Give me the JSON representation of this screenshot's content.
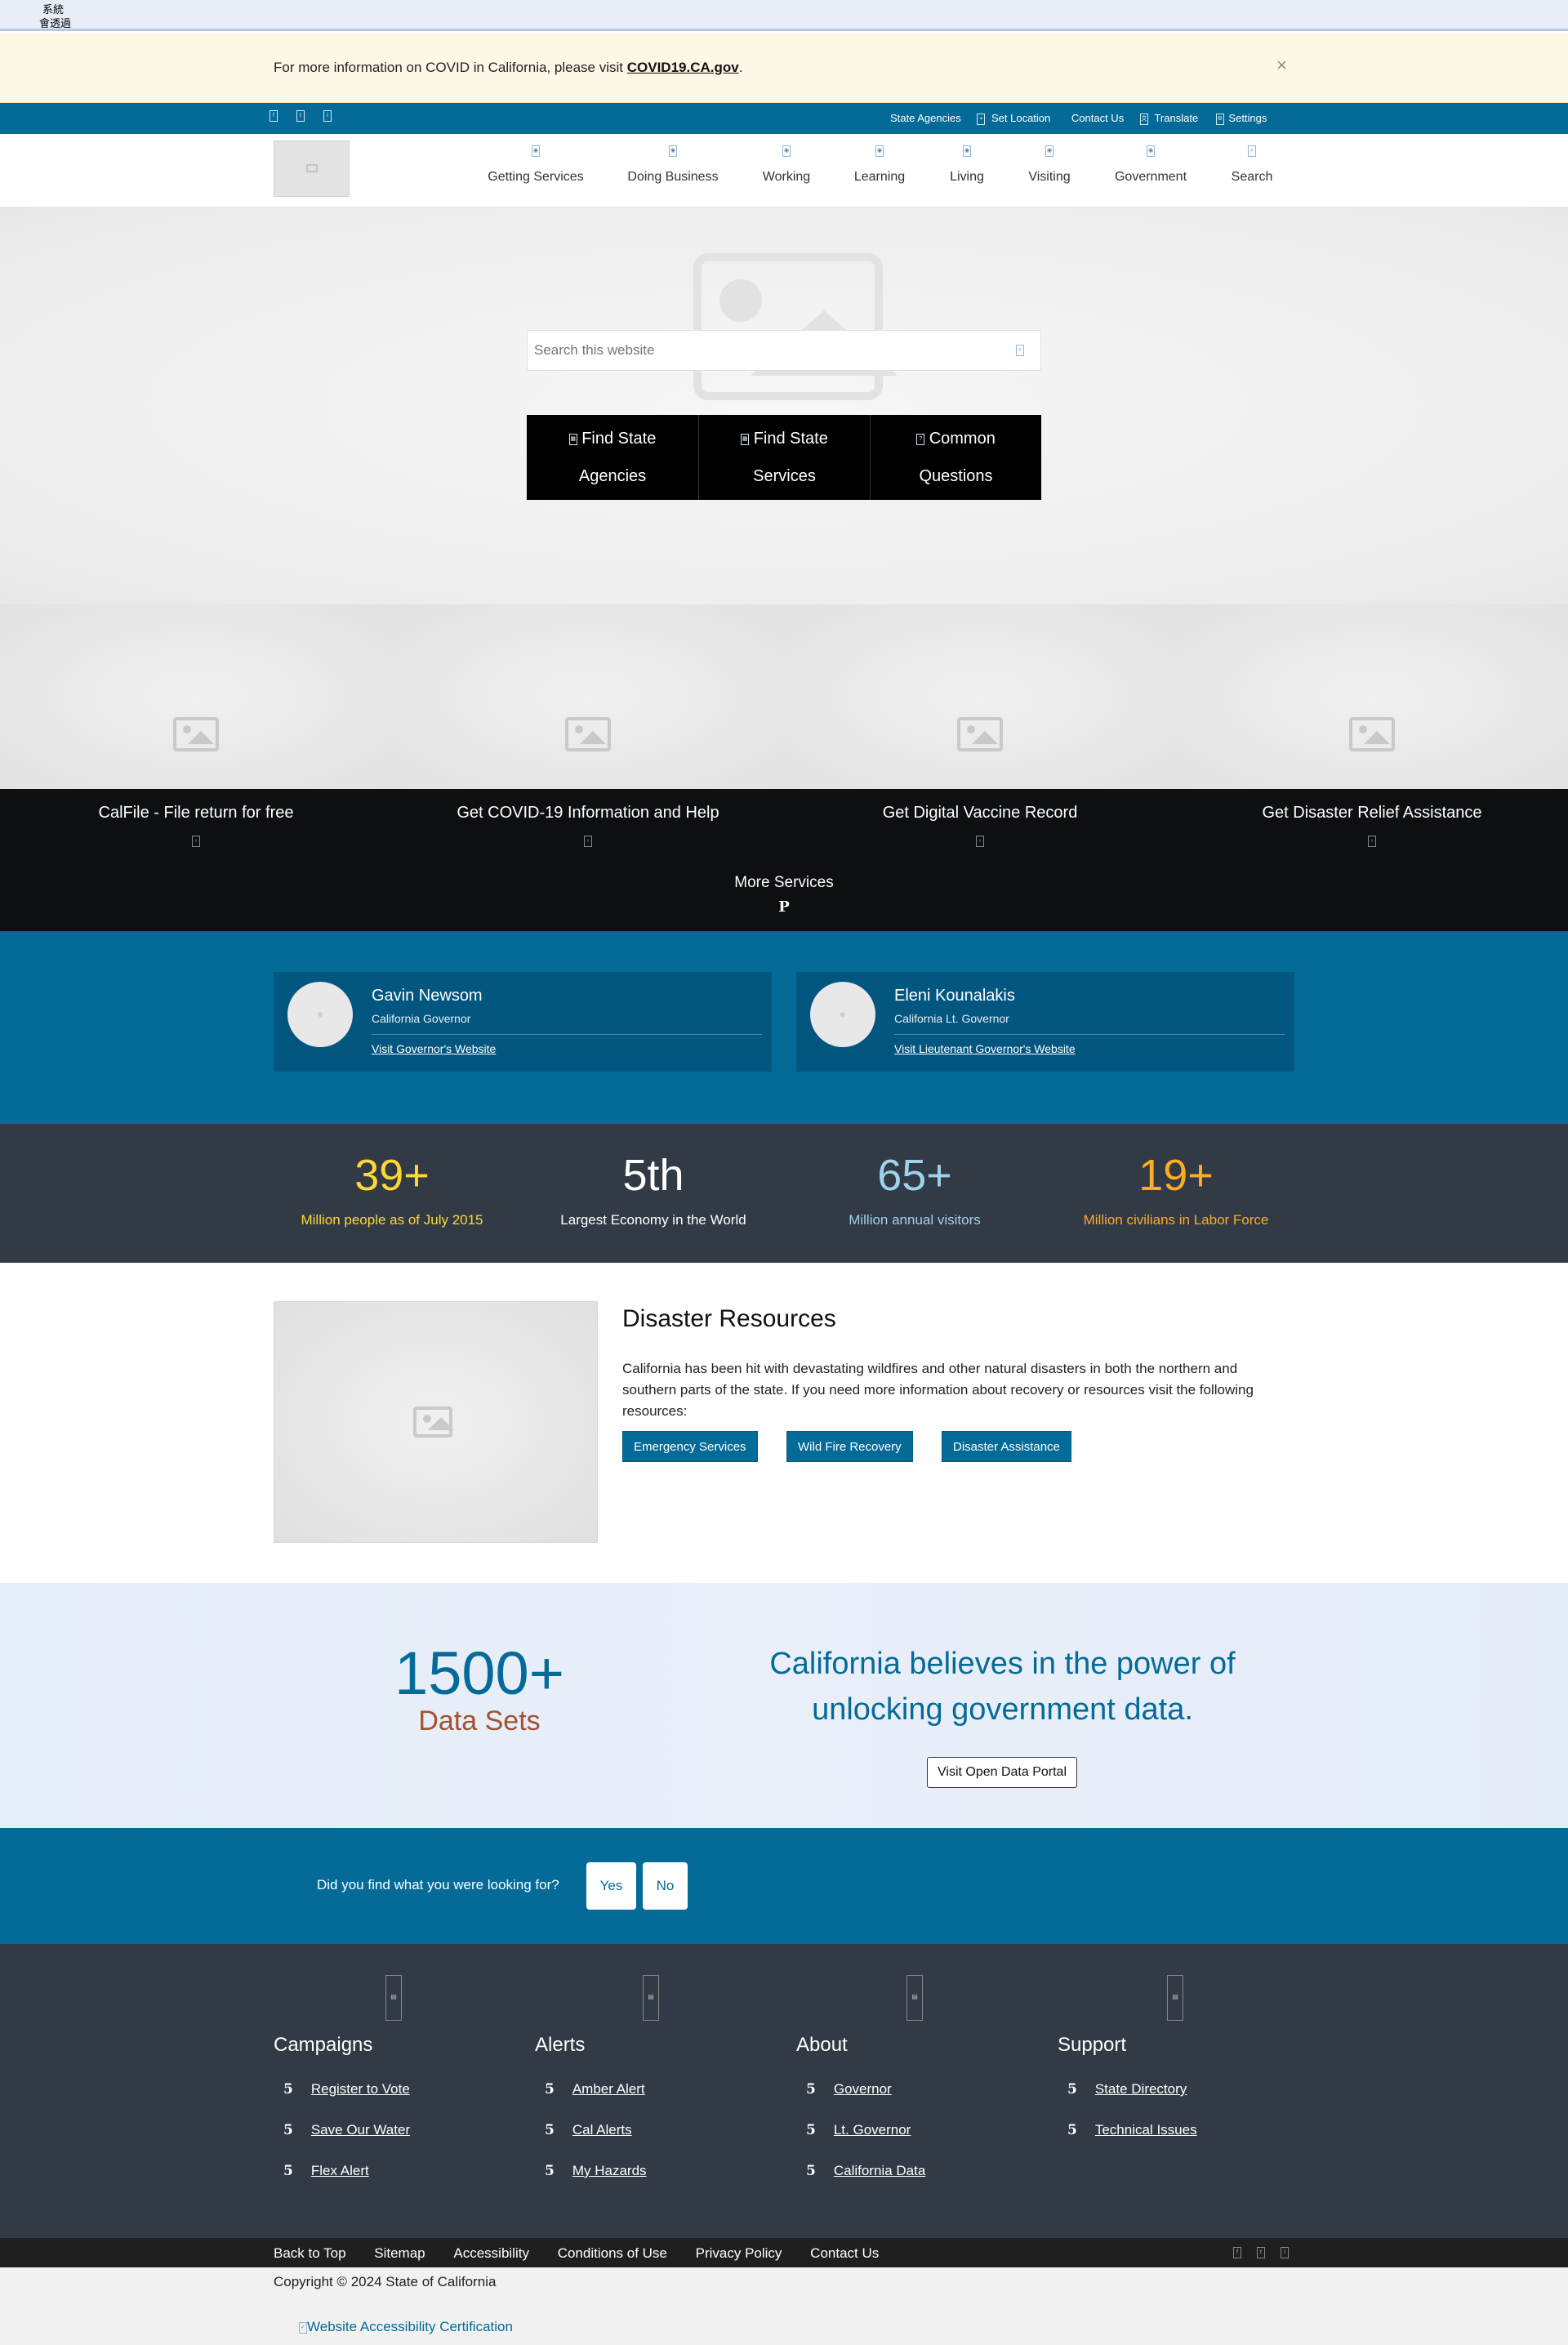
{
  "system_bar": {
    "line1": "系統",
    "line2": "會透過"
  },
  "alert": {
    "text": "For more information on COVID in California, please visit ",
    "link": "COVID19.CA.gov",
    "suffix": ".",
    "close": "×"
  },
  "utility": {
    "links": [
      "State Agencies",
      "Set Location",
      "Contact Us",
      "Translate",
      "Settings"
    ]
  },
  "nav": {
    "items": [
      "Getting Services",
      "Doing Business",
      "Working",
      "Learning",
      "Living",
      "Visiting",
      "Government",
      "Search"
    ]
  },
  "hero": {
    "search_placeholder": "Search this website",
    "buttons": [
      {
        "line1": "Find State",
        "line2": "Agencies"
      },
      {
        "line1": "Find State",
        "line2": "Services"
      },
      {
        "line1": "Common",
        "line2": "Questions"
      }
    ]
  },
  "services": {
    "cards": [
      "CalFile - File return for free",
      "Get COVID-19 Information and Help",
      "Get Digital Vaccine Record",
      "Get Disaster Relief Assistance"
    ],
    "more": "More Services",
    "more_glyph": "P"
  },
  "officials": [
    {
      "name": "Gavin Newsom",
      "title": "California Governor",
      "link": "Visit Governor's Website"
    },
    {
      "name": "Eleni Kounalakis",
      "title": "California Lt. Governor",
      "link": "Visit Lieutenant Governor's Website"
    }
  ],
  "stats": [
    {
      "value": "39+",
      "label": "Million people as of July 2015",
      "color": "#fdd835"
    },
    {
      "value": "5th",
      "label": "Largest Economy in the World",
      "color": "#ffffff"
    },
    {
      "value": "65+",
      "label": "Million annual visitors",
      "color": "#9fd1ee"
    },
    {
      "value": "19+",
      "label": "Million civilians in Labor Force",
      "color": "#fbad23"
    }
  ],
  "disaster": {
    "title": "Disaster Resources",
    "body": "California has been hit with devastating wildfires and other natural disasters in both the northern and southern parts of the state. If you need more information about recovery or resources visit the following resources:",
    "buttons": [
      "Emergency Services",
      "Wild Fire Recovery",
      "Disaster Assistance"
    ]
  },
  "data_section": {
    "number": "1500+",
    "label": "Data Sets",
    "heading_line1": "California believes in the power of",
    "heading_line2": "unlocking government data.",
    "button": "Visit Open Data Portal"
  },
  "feedback": {
    "question": "Did you find what you were looking for?",
    "yes": "Yes",
    "no": "No"
  },
  "footer": {
    "columns": [
      {
        "title": "Campaigns",
        "links": [
          "Register to Vote",
          "Save Our Water",
          "Flex Alert"
        ]
      },
      {
        "title": "Alerts",
        "links": [
          "Amber Alert",
          "Cal Alerts",
          "My Hazards"
        ]
      },
      {
        "title": "About",
        "links": [
          "Governor",
          "Lt. Governor",
          "California Data"
        ]
      },
      {
        "title": "Support",
        "links": [
          "State Directory",
          "Technical Issues"
        ]
      }
    ],
    "bullet": "5",
    "bottom_links": [
      "Back to Top",
      "Sitemap",
      "Accessibility",
      "Conditions of Use",
      "Privacy Policy",
      "Contact Us"
    ],
    "copyright": "Copyright © 2024 State of California",
    "certification": "Website Accessibility Certification"
  },
  "colors": {
    "brand_blue": "#046b99",
    "dark": "#323a45",
    "black": "#0d0f11",
    "alert_bg": "#fdf8e6"
  }
}
